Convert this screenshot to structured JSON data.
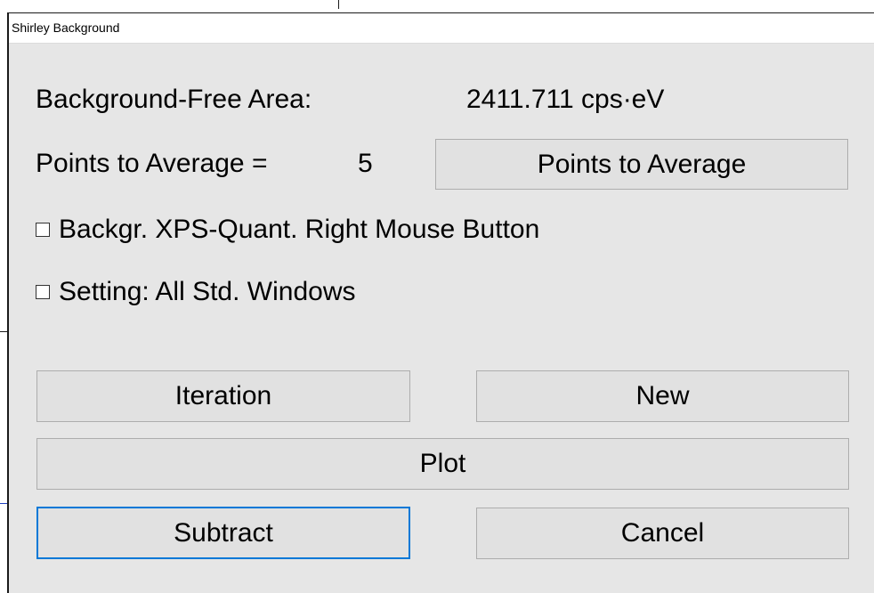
{
  "window": {
    "title": "Shirley Background"
  },
  "area": {
    "label": "Background-Free Area:",
    "value": "2411.711 cps·eV"
  },
  "points": {
    "label": "Points to Average =",
    "value": "5",
    "button_label": "Points to Average"
  },
  "options": {
    "right_mouse_label": "Backgr. XPS-Quant. Right Mouse Button",
    "right_mouse_checked": false,
    "all_windows_label": "Setting: All Std. Windows",
    "all_windows_checked": false
  },
  "actions": {
    "iteration_label": "Iteration",
    "new_label": "New",
    "plot_label": "Plot",
    "subtract_label": "Subtract",
    "cancel_label": "Cancel"
  },
  "colors": {
    "dialog_bg": "#e6e6e6",
    "button_bg": "#e1e1e1",
    "focus_border": "#0078d7"
  }
}
